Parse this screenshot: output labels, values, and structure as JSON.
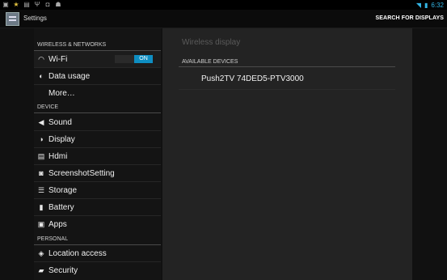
{
  "statusbar": {
    "left_icons": [
      "image-icon",
      "star-icon",
      "gallery-icon",
      "usb-icon",
      "shield-icon",
      "android-icon"
    ],
    "wifi_icon": "wifi-icon",
    "time": "6:32"
  },
  "actionbar": {
    "title": "Settings",
    "action": "SEARCH FOR DISPLAYS"
  },
  "sidebar": {
    "sections": [
      {
        "header": "WIRELESS & NETWORKS"
      },
      {
        "header": "DEVICE"
      },
      {
        "header": "PERSONAL"
      }
    ],
    "items": [
      {
        "label": "Wi-Fi",
        "icon": "wifi-icon"
      },
      {
        "label": "Data usage",
        "icon": "data-usage-icon"
      },
      {
        "label": "More…",
        "icon": ""
      },
      {
        "label": "Sound",
        "icon": "speaker-icon"
      },
      {
        "label": "Display",
        "icon": "display-icon"
      },
      {
        "label": "Hdmi",
        "icon": "hdmi-icon"
      },
      {
        "label": "ScreenshotSetting",
        "icon": "camera-icon"
      },
      {
        "label": "Storage",
        "icon": "storage-icon"
      },
      {
        "label": "Battery",
        "icon": "battery-icon"
      },
      {
        "label": "Apps",
        "icon": "apps-icon"
      },
      {
        "label": "Location access",
        "icon": "location-icon"
      },
      {
        "label": "Security",
        "icon": "lock-icon"
      }
    ],
    "wifi_toggle": "ON"
  },
  "main": {
    "title": "Wireless display",
    "available_header": "AVAILABLE DEVICES",
    "devices": [
      "Push2TV 74DED5-PTV3000"
    ]
  },
  "colors": {
    "accent": "#33b5e5",
    "toggle_on": "#0e8ec2"
  }
}
